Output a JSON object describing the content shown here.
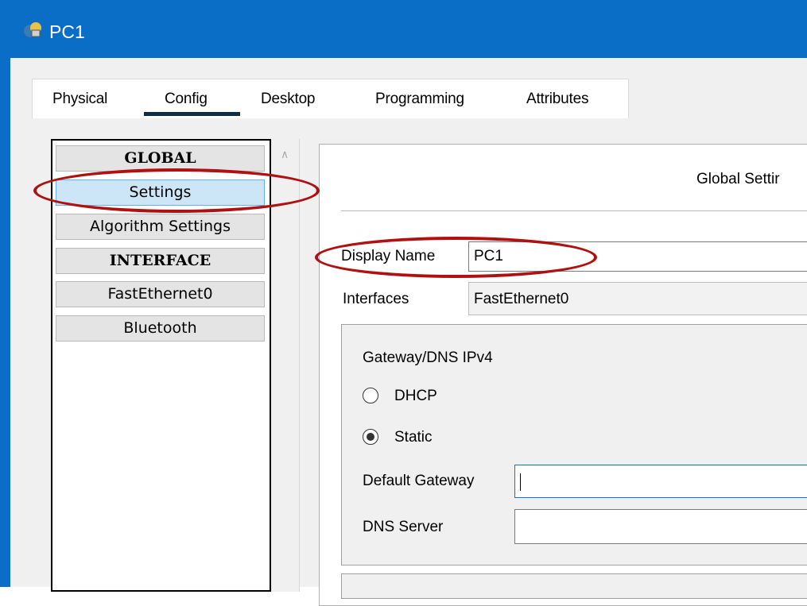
{
  "window": {
    "title": "PC1",
    "app_icon": "pc-icon"
  },
  "tabs": [
    {
      "label": "Physical",
      "active": false
    },
    {
      "label": "Config",
      "active": true
    },
    {
      "label": "Desktop",
      "active": false
    },
    {
      "label": "Programming",
      "active": false
    },
    {
      "label": "Attributes",
      "active": false
    }
  ],
  "sidebar": {
    "items": [
      {
        "label": "GLOBAL",
        "type": "header"
      },
      {
        "label": "Settings",
        "type": "item",
        "selected": true
      },
      {
        "label": "Algorithm Settings",
        "type": "item"
      },
      {
        "label": "INTERFACE",
        "type": "header"
      },
      {
        "label": "FastEthernet0",
        "type": "item"
      },
      {
        "label": "Bluetooth",
        "type": "item"
      }
    ]
  },
  "panel": {
    "title": "Global Settir",
    "display_name_label": "Display Name",
    "display_name_value": "PC1",
    "interfaces_label": "Interfaces",
    "interfaces_value": "FastEthernet0",
    "gateway": {
      "group_title": "Gateway/DNS IPv4",
      "dhcp_label": "DHCP",
      "static_label": "Static",
      "selected": "Static",
      "default_gateway_label": "Default Gateway",
      "default_gateway_value": "",
      "dns_server_label": "DNS Server",
      "dns_server_value": ""
    }
  },
  "annotations": {
    "highlight_color": "#b01010"
  },
  "colors": {
    "titlebar": "#0a6ec6",
    "selected_item": "#cde6f7"
  }
}
